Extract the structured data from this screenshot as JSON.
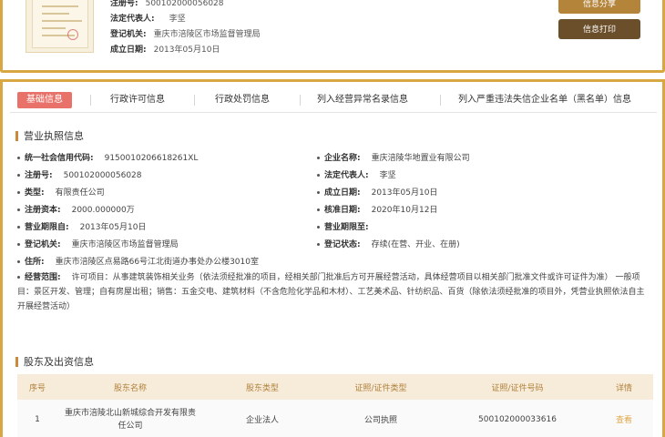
{
  "summary": {
    "reg_no_label": "注册号:",
    "reg_no_value": "500102000056028",
    "legal_rep_label": "法定代表人:",
    "legal_rep_value": "李坚",
    "authority_label": "登记机关:",
    "authority_value": "重庆市涪陵区市场监督管理局",
    "founded_label": "成立日期:",
    "founded_value": "2013年05月10日",
    "share_button": "信息分享",
    "print_button": "信息打印"
  },
  "tabs": [
    {
      "label": "基础信息",
      "active": true
    },
    {
      "label": "行政许可信息",
      "active": false
    },
    {
      "label": "行政处罚信息",
      "active": false
    },
    {
      "label": "列入经营异常名录信息",
      "active": false
    },
    {
      "label": "列入严重违法失信企业名单（黑名单）信息",
      "active": false
    }
  ],
  "license": {
    "section_title": "营业执照信息",
    "left": [
      {
        "label": "统一社会信用代码:",
        "value": "9150010206618261XL"
      },
      {
        "label": "注册号:",
        "value": "500102000056028"
      },
      {
        "label": "类型:",
        "value": "有限责任公司"
      },
      {
        "label": "注册资本:",
        "value": "2000.000000万"
      },
      {
        "label": "营业期限自:",
        "value": "2013年05月10日"
      },
      {
        "label": "登记机关:",
        "value": "重庆市涪陵区市场监督管理局"
      },
      {
        "label": "住所:",
        "value": "重庆市涪陵区点易路66号江北街道办事处办公楼3010室"
      }
    ],
    "right": [
      {
        "label": "企业名称:",
        "value": "重庆涪陵华地置业有限公司"
      },
      {
        "label": "法定代表人:",
        "value": "李坚"
      },
      {
        "label": "成立日期:",
        "value": "2013年05月10日"
      },
      {
        "label": "核准日期:",
        "value": "2020年10月12日"
      },
      {
        "label": "营业期限至:",
        "value": ""
      },
      {
        "label": "登记状态:",
        "value": "存续(在营、开业、在册)"
      }
    ],
    "scope_label": "经营范围:",
    "scope_value": "许可项目：从事建筑装饰相关业务（依法须经批准的项目，经相关部门批准后方可开展经营活动，具体经营项目以相关部门批准文件或许可证件为准） 一般项目：景区开发、管理；自有房屋出租；销售：五金交电、建筑材料（不含危险化学品和木材）、工艺美术品、针纺织品、百货（除依法须经批准的项目外，凭营业执照依法自主开展经营活动）"
  },
  "shareholders": {
    "section_title": "股东及出资信息",
    "columns": [
      "序号",
      "股东名称",
      "股东类型",
      "证照/证件类型",
      "证照/证件号码",
      "详情"
    ],
    "rows": [
      {
        "index": "1",
        "name": "重庆市涪陵北山新城综合开发有限责任公司",
        "type": "企业法人",
        "cert_type": "公司执照",
        "cert_no": "500102000033616",
        "detail": "查看"
      }
    ]
  },
  "colors": {
    "accent_border": "#d9a741",
    "active_tab": "#e8716a",
    "share_button": "#b4843b",
    "print_button": "#6b4e2a",
    "table_header_bg": "#f7ecd9"
  }
}
